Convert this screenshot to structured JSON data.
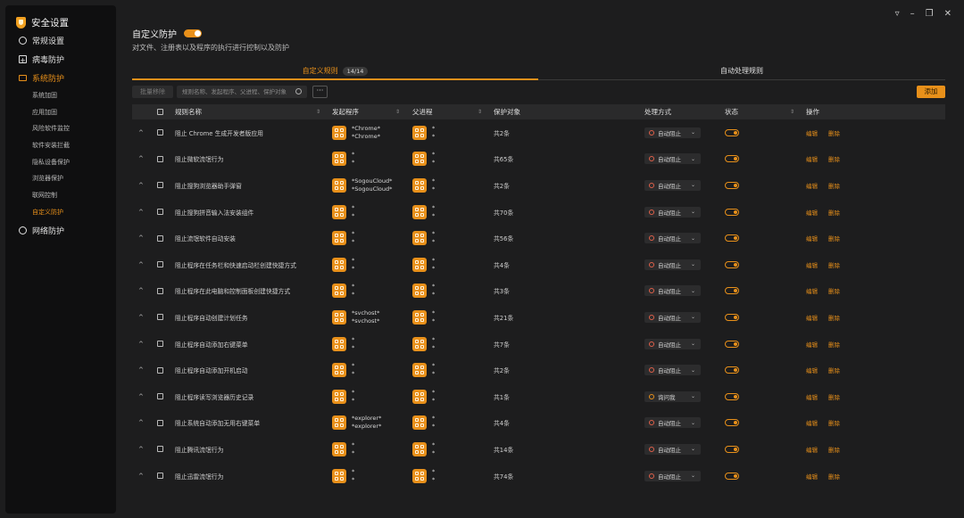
{
  "app": {
    "title": "安全设置"
  },
  "sidebar": {
    "items": [
      {
        "label": "常规设置",
        "icon": "gear-icon",
        "active": false,
        "sub": []
      },
      {
        "label": "病毒防护",
        "icon": "plus-box-icon",
        "active": false,
        "sub": []
      },
      {
        "label": "系统防护",
        "icon": "monitor-icon",
        "active": true,
        "sub": [
          "系统加固",
          "应用加固",
          "风险软件监控",
          "软件安装拦截",
          "隐私设备保护",
          "浏览器保护",
          "联网控制",
          "自定义防护"
        ],
        "active_sub": "自定义防护"
      },
      {
        "label": "网络防护",
        "icon": "globe-icon",
        "active": false,
        "sub": []
      }
    ]
  },
  "window_controls": [
    "menu-icon",
    "minimize-icon",
    "restore-icon",
    "close-icon"
  ],
  "main": {
    "title": "自定义防护",
    "toggle_on": true,
    "subtitle": "对文件、注册表以及程序的执行进行控制以及防护",
    "tabs": [
      {
        "label": "自定义规则",
        "badge": "14/14",
        "active": true
      },
      {
        "label": "自动处理规则",
        "active": false
      }
    ],
    "toolbar": {
      "batch_label": "批量移除",
      "search_placeholder": "规则名称、发起程序、父进程、保护对象",
      "more_label": "···",
      "add_label": "添加"
    },
    "columns": [
      "规则名称",
      "发起程序",
      "父进程",
      "保护对象",
      "处理方式",
      "状态",
      "操作"
    ],
    "rows": [
      {
        "name": "阻止 Chrome 生成开发者版应用",
        "proc": [
          "*Chrome*",
          "*Chrome*"
        ],
        "parent": [
          "*",
          "*"
        ],
        "target": "共2条",
        "mode": "自动阻止",
        "mode_type": "block",
        "enabled": true
      },
      {
        "name": "阻止微软流氓行为",
        "proc": [
          "*",
          "*"
        ],
        "parent": [
          "*",
          "*"
        ],
        "target": "共65条",
        "mode": "自动阻止",
        "mode_type": "block",
        "enabled": true
      },
      {
        "name": "阻止搜狗浏览器助手弹窗",
        "proc": [
          "*SogouCloud*",
          "*SogouCloud*"
        ],
        "parent": [
          "*",
          "*"
        ],
        "target": "共2条",
        "mode": "自动阻止",
        "mode_type": "block",
        "enabled": true
      },
      {
        "name": "阻止搜狗拼音输入法安装组件",
        "proc": [
          "*",
          "*"
        ],
        "parent": [
          "*",
          "*"
        ],
        "target": "共70条",
        "mode": "自动阻止",
        "mode_type": "block",
        "enabled": true
      },
      {
        "name": "阻止流氓软件自动安装",
        "proc": [
          "*",
          "*"
        ],
        "parent": [
          "*",
          "*"
        ],
        "target": "共56条",
        "mode": "自动阻止",
        "mode_type": "block",
        "enabled": true
      },
      {
        "name": "阻止程序在任务栏和快速启动栏创建快捷方式",
        "proc": [
          "*",
          "*"
        ],
        "parent": [
          "*",
          "*"
        ],
        "target": "共4条",
        "mode": "自动阻止",
        "mode_type": "block",
        "enabled": true
      },
      {
        "name": "阻止程序在此电脑和控制面板创建快捷方式",
        "proc": [
          "*",
          "*"
        ],
        "parent": [
          "*",
          "*"
        ],
        "target": "共3条",
        "mode": "自动阻止",
        "mode_type": "block",
        "enabled": true
      },
      {
        "name": "阻止程序自动创建计划任务",
        "proc": [
          "*svchost*",
          "*svchost*"
        ],
        "parent": [
          "*",
          "*"
        ],
        "target": "共21条",
        "mode": "自动阻止",
        "mode_type": "block",
        "enabled": true
      },
      {
        "name": "阻止程序自动添加右键菜单",
        "proc": [
          "*",
          "*"
        ],
        "parent": [
          "*",
          "*"
        ],
        "target": "共7条",
        "mode": "自动阻止",
        "mode_type": "block",
        "enabled": true
      },
      {
        "name": "阻止程序自动添加开机启动",
        "proc": [
          "*",
          "*"
        ],
        "parent": [
          "*",
          "*"
        ],
        "target": "共2条",
        "mode": "自动阻止",
        "mode_type": "block",
        "enabled": true
      },
      {
        "name": "阻止程序读写浏览器历史记录",
        "proc": [
          "*",
          "*"
        ],
        "parent": [
          "*",
          "*"
        ],
        "target": "共1条",
        "mode": "询问我",
        "mode_type": "ask",
        "enabled": true
      },
      {
        "name": "阻止系统自动添加无用右键菜单",
        "proc": [
          "*explorer*",
          "*explorer*"
        ],
        "parent": [
          "*",
          "*"
        ],
        "target": "共4条",
        "mode": "自动阻止",
        "mode_type": "block",
        "enabled": true
      },
      {
        "name": "阻止腾讯流氓行为",
        "proc": [
          "*",
          "*"
        ],
        "parent": [
          "*",
          "*"
        ],
        "target": "共14条",
        "mode": "自动阻止",
        "mode_type": "block",
        "enabled": true
      },
      {
        "name": "阻止迅雷流氓行为",
        "proc": [
          "*",
          "*"
        ],
        "parent": [
          "*",
          "*"
        ],
        "target": "共74条",
        "mode": "自动阻止",
        "mode_type": "block",
        "enabled": true
      }
    ],
    "row_actions": {
      "edit": "编辑",
      "delete": "删除"
    }
  },
  "colors": {
    "accent": "#e8901a",
    "background": "#1d1d1e",
    "sidebar": "#0f0f10"
  }
}
